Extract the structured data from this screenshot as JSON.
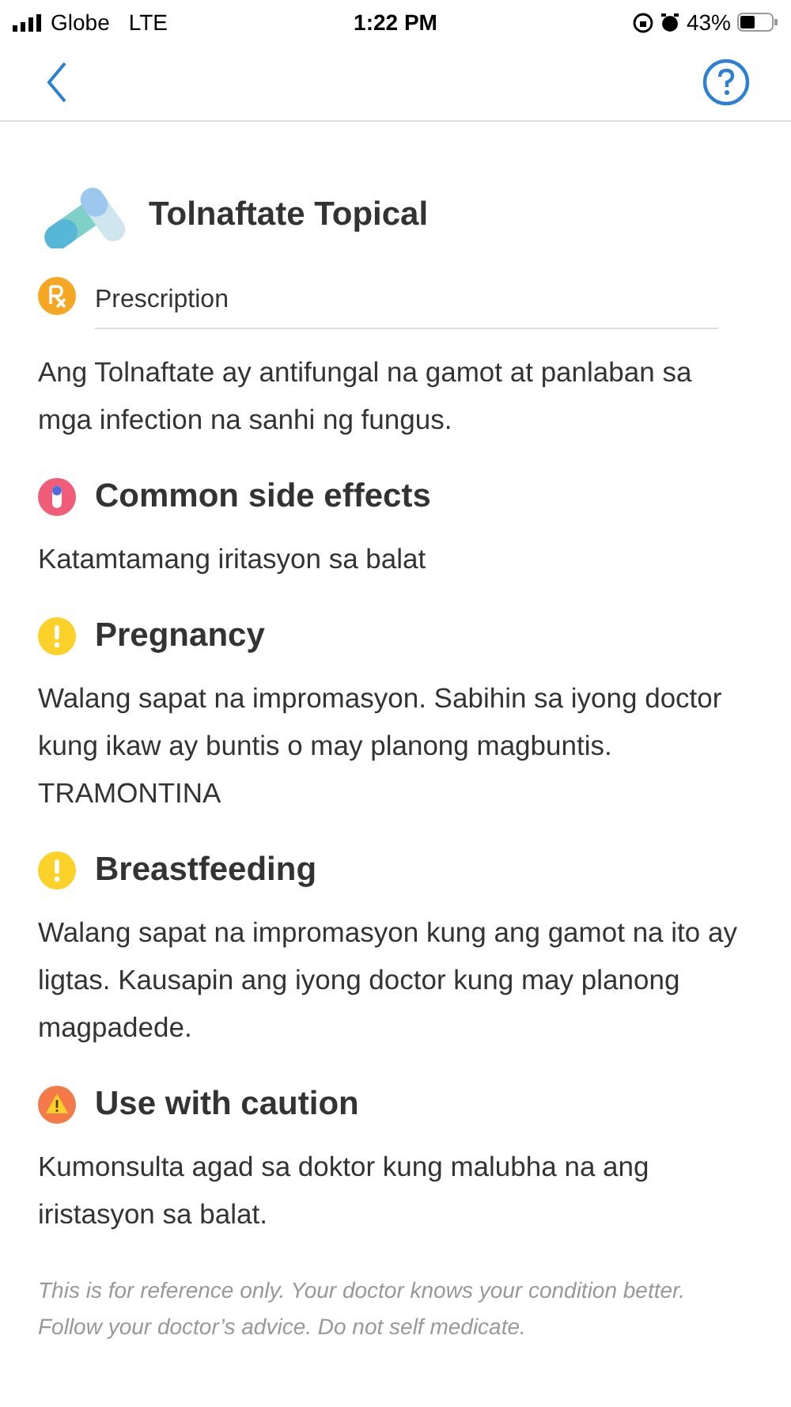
{
  "status_bar": {
    "carrier": "Globe",
    "network": "LTE",
    "time": "1:22 PM",
    "battery": "43%"
  },
  "drug": {
    "name": "Tolnaftate Topical",
    "type": "Prescription",
    "description": "Ang Tolnaftate ay antifungal na gamot at panlaban sa mga infection na sanhi ng fungus."
  },
  "sections": [
    {
      "kind": "side_effects",
      "title": "Common side effects",
      "text": "Katamtamang iritasyon sa balat"
    },
    {
      "kind": "info",
      "title": "Pregnancy",
      "text": "Walang sapat na impromasyon. Sabihin sa iyong doctor kung ikaw ay buntis o may planong magbuntis.  TRAMONTINA"
    },
    {
      "kind": "info",
      "title": "Breastfeeding",
      "text": "Walang sapat na impromasyon kung ang gamot na ito ay ligtas. Kausapin ang iyong doctor kung may planong magpadede."
    },
    {
      "kind": "caution",
      "title": "Use with caution",
      "text": "Kumonsulta agad sa doktor kung malubha na ang iristasyon sa balat."
    }
  ],
  "disclaimer": "This is for reference only. Your doctor knows your condition better. Follow your doctor’s advice. Do not self medicate."
}
